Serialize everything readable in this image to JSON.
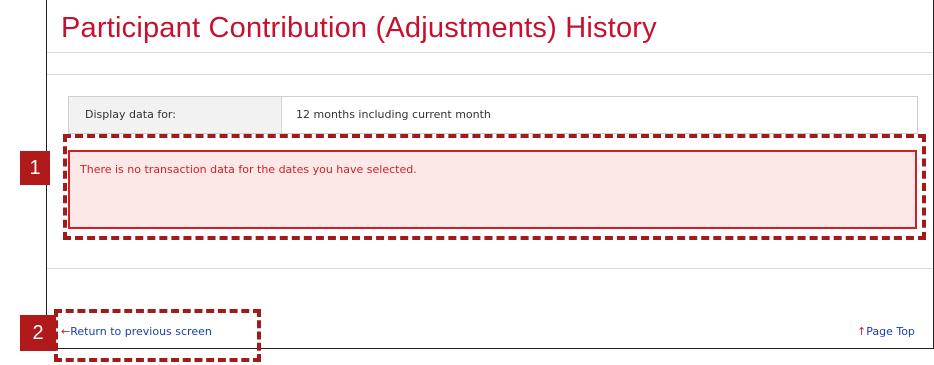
{
  "page": {
    "title": "Participant Contribution (Adjustments) History"
  },
  "filter": {
    "label": "Display data for:",
    "value": "12 months including current month"
  },
  "message": {
    "error_text": "There is no transaction data for the dates you have selected."
  },
  "callouts": {
    "marker_1": "1",
    "marker_2": "2"
  },
  "footer": {
    "back_arrow": "←",
    "back_label": "Return to previous screen",
    "top_arrow": "↑",
    "top_label": "Page Top"
  },
  "colors": {
    "title": "#c8102e",
    "error_border": "#d01f26",
    "error_background": "#fde8e8",
    "callout": "#b01a1a",
    "link": "#1a3fa8"
  }
}
